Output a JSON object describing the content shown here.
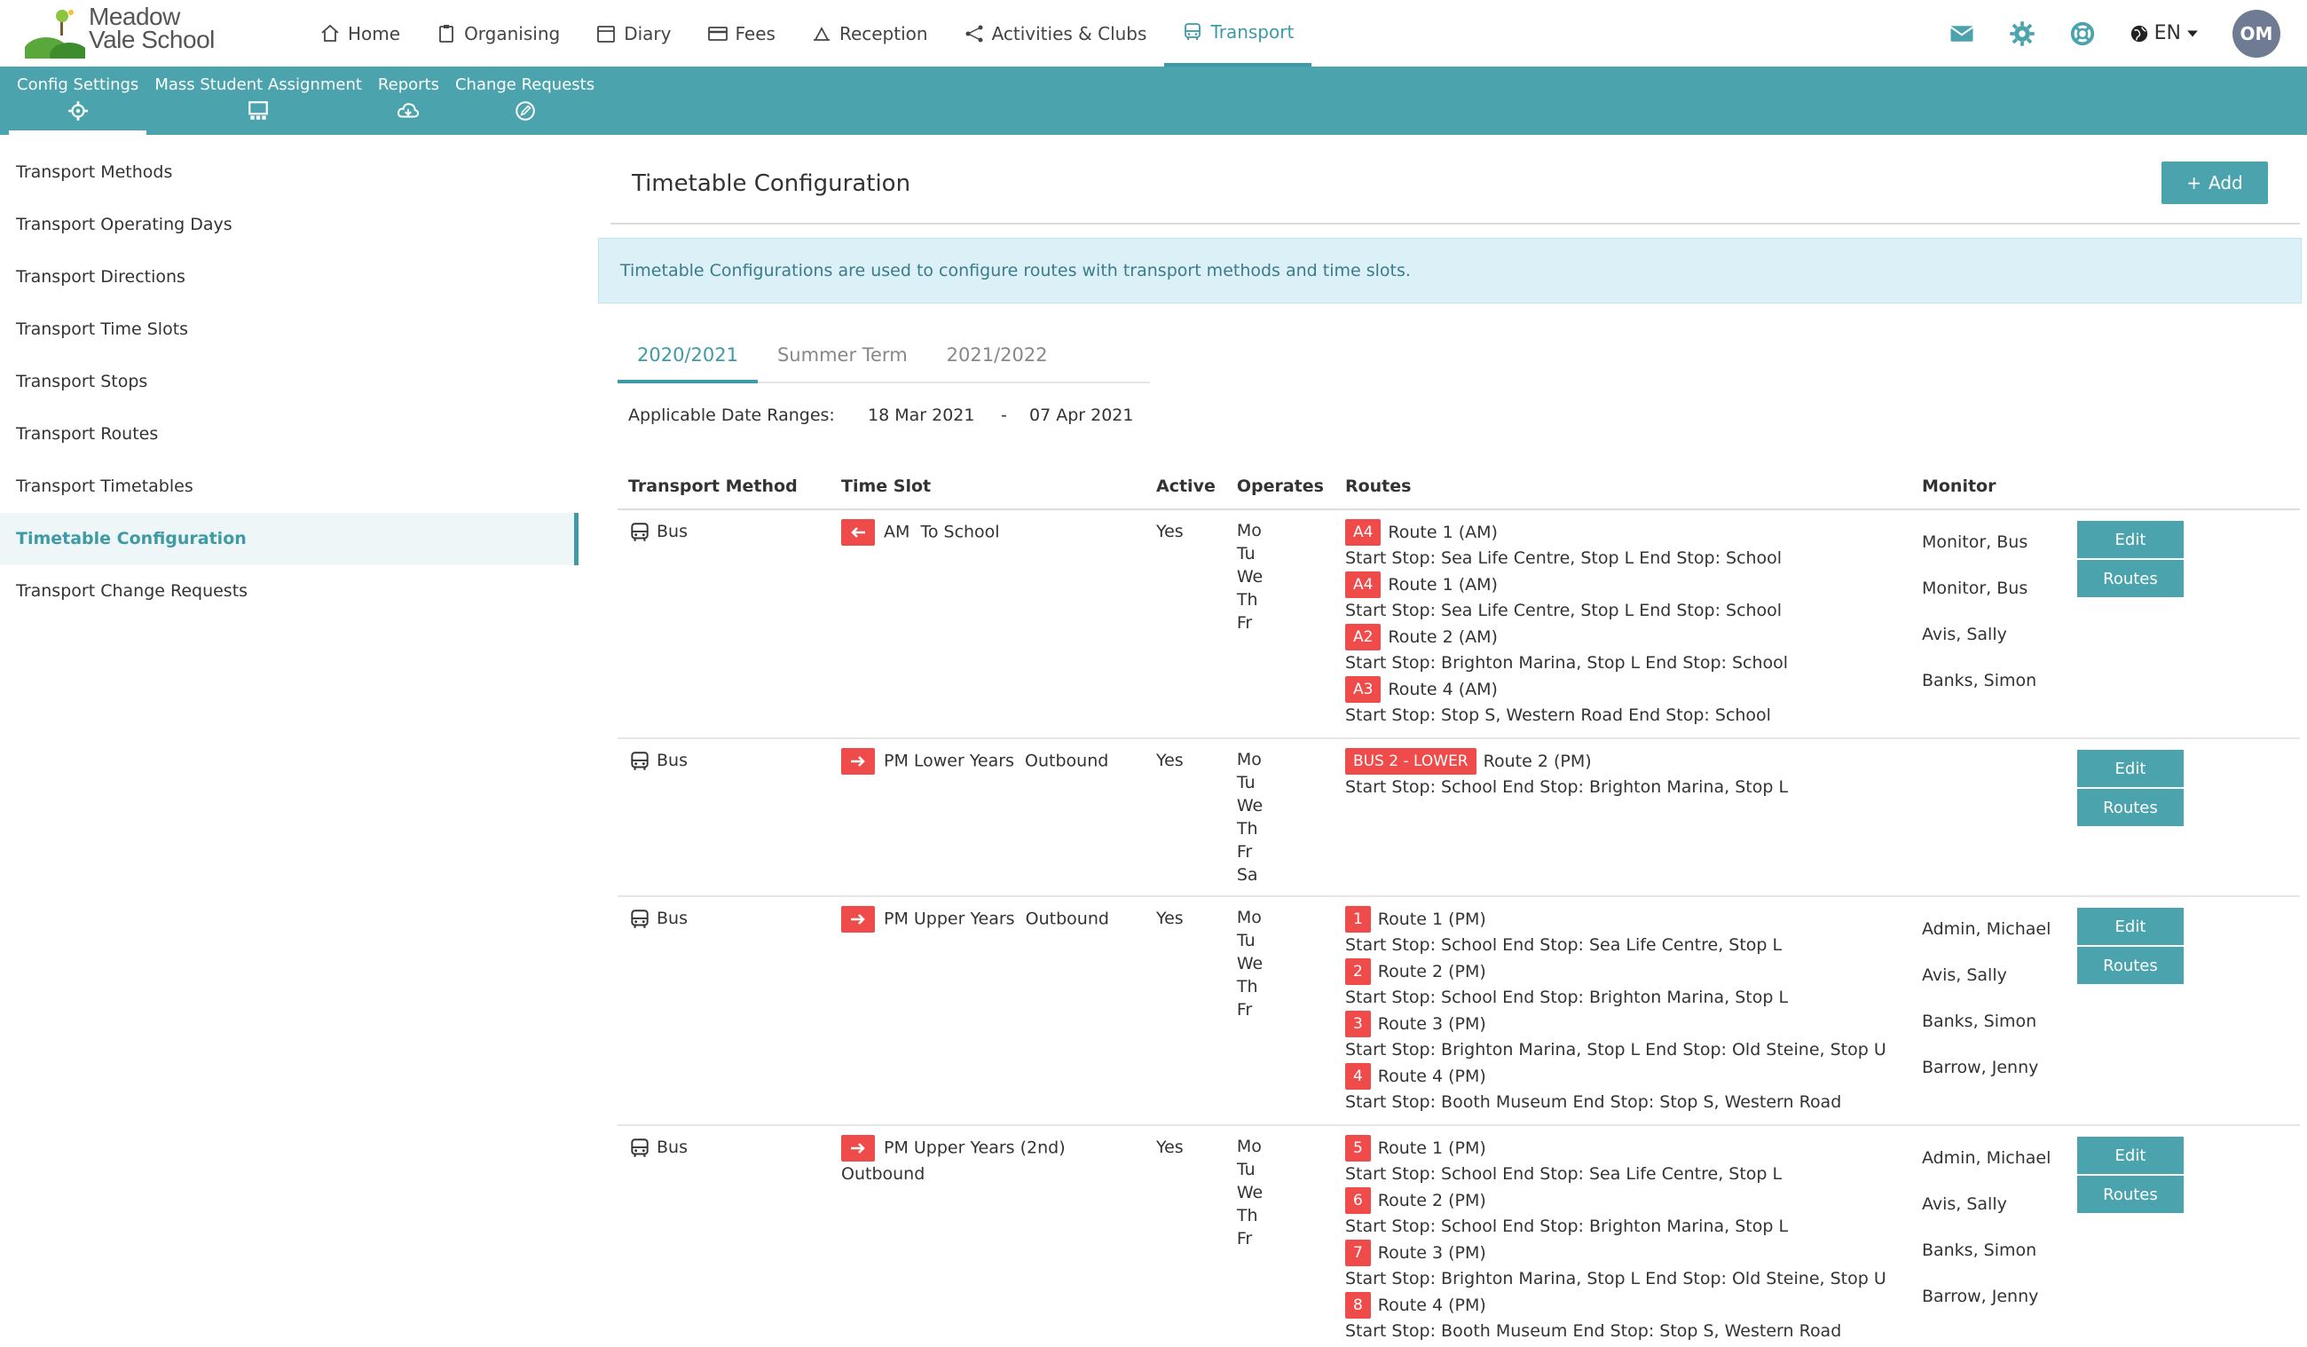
{
  "brand": {
    "line1": "Meadow",
    "line2": "Vale School"
  },
  "nav": {
    "items": [
      {
        "label": "Home",
        "icon": "home-icon"
      },
      {
        "label": "Organising",
        "icon": "clipboard-icon"
      },
      {
        "label": "Diary",
        "icon": "calendar-icon"
      },
      {
        "label": "Fees",
        "icon": "card-icon"
      },
      {
        "label": "Reception",
        "icon": "reception-icon"
      },
      {
        "label": "Activities & Clubs",
        "icon": "network-icon"
      },
      {
        "label": "Transport",
        "icon": "bus-icon",
        "active": true
      }
    ],
    "lang": "EN",
    "avatar": "OM"
  },
  "subnav": [
    {
      "label": "Config Settings",
      "icon": "gear-icon",
      "active": true
    },
    {
      "label": "Mass Student Assignment",
      "icon": "assignment-icon"
    },
    {
      "label": "Reports",
      "icon": "cloud-download-icon"
    },
    {
      "label": "Change Requests",
      "icon": "edit-icon"
    }
  ],
  "sidebar": [
    {
      "label": "Transport Methods"
    },
    {
      "label": "Transport Operating Days"
    },
    {
      "label": "Transport Directions"
    },
    {
      "label": "Transport Time Slots"
    },
    {
      "label": "Transport Stops"
    },
    {
      "label": "Transport Routes"
    },
    {
      "label": "Transport Timetables"
    },
    {
      "label": "Timetable Configuration",
      "active": true
    },
    {
      "label": "Transport Change Requests"
    }
  ],
  "page": {
    "title": "Timetable Configuration",
    "add_label": "Add",
    "info": "Timetable Configurations are used to configure routes with transport methods and time slots.",
    "tabs": [
      "2020/2021",
      "Summer Term",
      "2021/2022"
    ],
    "date_label": "Applicable Date Ranges:",
    "date_from": "18 Mar 2021",
    "date_sep": "-",
    "date_to": "07 Apr 2021"
  },
  "table": {
    "headers": [
      "Transport Method",
      "Time Slot",
      "Active",
      "Operates",
      "Routes",
      "Monitor"
    ],
    "edit_label": "Edit",
    "routes_label": "Routes",
    "rows": [
      {
        "method": "Bus",
        "direction": "left",
        "slot": "AM  To School",
        "active": "Yes",
        "days": [
          "Mo",
          "Tu",
          "We",
          "Th",
          "Fr"
        ],
        "routes": [
          {
            "badge": "A4",
            "name": "Route 1 (AM)",
            "stops": "Start Stop: Sea Life Centre, Stop L End Stop: School"
          },
          {
            "badge": "A4",
            "name": "Route 1 (AM)",
            "stops": "Start Stop: Sea Life Centre, Stop L End Stop: School"
          },
          {
            "badge": "A2",
            "name": "Route 2 (AM)",
            "stops": "Start Stop: Brighton Marina, Stop L End Stop: School"
          },
          {
            "badge": "A3",
            "name": "Route 4 (AM)",
            "stops": "Start Stop: Stop S, Western Road End Stop: School"
          }
        ],
        "monitors": [
          "Monitor, Bus",
          "Monitor, Bus",
          "Avis, Sally",
          "Banks, Simon"
        ]
      },
      {
        "method": "Bus",
        "direction": "right",
        "slot": "PM Lower Years  Outbound",
        "active": "Yes",
        "days": [
          "Mo",
          "Tu",
          "We",
          "Th",
          "Fr",
          "Sa"
        ],
        "routes": [
          {
            "badge": "BUS 2 - LOWER",
            "name": "Route 2 (PM)",
            "stops": "Start Stop: School End Stop: Brighton Marina, Stop L"
          }
        ],
        "monitors": []
      },
      {
        "method": "Bus",
        "direction": "right",
        "slot": "PM Upper Years  Outbound",
        "active": "Yes",
        "days": [
          "Mo",
          "Tu",
          "We",
          "Th",
          "Fr"
        ],
        "routes": [
          {
            "badge": "1",
            "name": "Route 1 (PM)",
            "stops": "Start Stop: School End Stop: Sea Life Centre, Stop L"
          },
          {
            "badge": "2",
            "name": "Route 2 (PM)",
            "stops": "Start Stop: School End Stop: Brighton Marina, Stop L"
          },
          {
            "badge": "3",
            "name": "Route 3 (PM)",
            "stops": "Start Stop: Brighton Marina, Stop L End Stop: Old Steine, Stop U"
          },
          {
            "badge": "4",
            "name": "Route 4 (PM)",
            "stops": "Start Stop: Booth Museum End Stop: Stop S, Western Road"
          }
        ],
        "monitors": [
          "Admin, Michael",
          "Avis, Sally",
          "Banks, Simon",
          "Barrow, Jenny"
        ]
      },
      {
        "method": "Bus",
        "direction": "right",
        "slot": "PM Upper Years (2nd) Outbound",
        "active": "Yes",
        "days": [
          "Mo",
          "Tu",
          "We",
          "Th",
          "Fr"
        ],
        "routes": [
          {
            "badge": "5",
            "name": "Route 1 (PM)",
            "stops": "Start Stop: School End Stop: Sea Life Centre, Stop L"
          },
          {
            "badge": "6",
            "name": "Route 2 (PM)",
            "stops": "Start Stop: School End Stop: Brighton Marina, Stop L"
          },
          {
            "badge": "7",
            "name": "Route 3 (PM)",
            "stops": "Start Stop: Brighton Marina, Stop L End Stop: Old Steine, Stop U"
          },
          {
            "badge": "8",
            "name": "Route 4 (PM)",
            "stops": "Start Stop: Booth Museum End Stop: Stop S, Western Road"
          }
        ],
        "monitors": [
          "Admin, Michael",
          "Avis, Sally",
          "Banks, Simon",
          "Barrow, Jenny"
        ]
      }
    ]
  },
  "colors": {
    "accent": "#4aa3ad",
    "badge": "#ef4b4b",
    "info_bg": "#dcf0f7"
  }
}
